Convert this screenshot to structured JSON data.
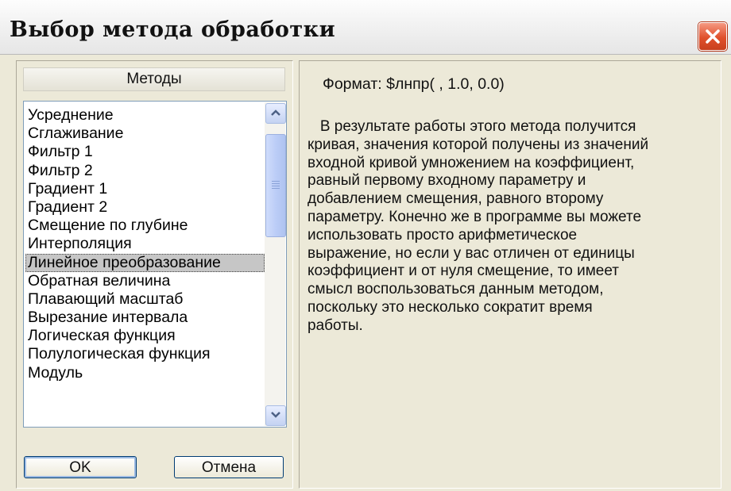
{
  "window": {
    "title": "Выбор метода обработки",
    "close_icon": "close-icon"
  },
  "methods": {
    "header": "Методы",
    "items": [
      "Усреднение",
      "Сглаживание",
      "Фильтр 1",
      "Фильтр 2",
      "Градиент 1",
      "Градиент 2",
      "Смещение по глубине",
      "Интерполяция",
      "Линейное преобразование",
      "Обратная величина",
      "Плавающий масштаб",
      "Вырезание интервала",
      "Логическая функция",
      "Полулогическая функция",
      "Модуль"
    ],
    "selected": "Линейное преобразование"
  },
  "buttons": {
    "ok": "OK",
    "cancel": "Отмена"
  },
  "description": {
    "format": "Формат:  $лнпр( , 1.0, 0.0)",
    "lines": [
      "   В результате работы этого метода получится",
      "кривая, значения которой получены из значений",
      "входной кривой умножением на коэффициент,",
      "равный первому входному параметру и",
      "добавлением смещения, равного второму",
      "параметру. Конечно же в программе вы можете",
      "использовать просто арифметическое",
      "выражение, но если у вас отличен от единицы",
      "коэффициент и от нуля смещение, то имеет",
      "смысл воспользоваться данным методом,",
      "поскольку это несколько сократит время",
      "работы."
    ]
  }
}
